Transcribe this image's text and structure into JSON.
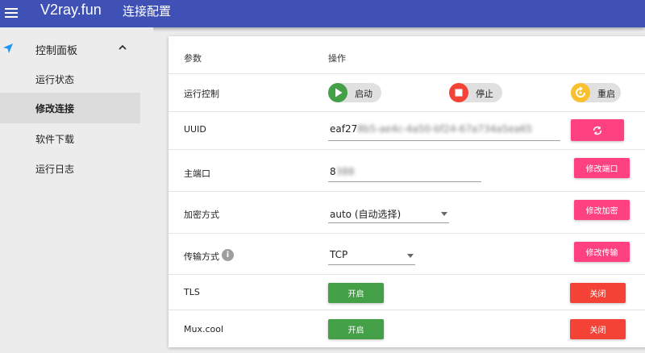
{
  "app": {
    "brand": "V2ray.fun",
    "page_title": "连接配置",
    "primary_color": "#3f51b5"
  },
  "sidebar": {
    "group_label": "控制面板",
    "items": [
      {
        "label": "运行状态"
      },
      {
        "label": "修改连接",
        "active": true
      },
      {
        "label": "软件下载"
      },
      {
        "label": "运行日志"
      }
    ]
  },
  "table": {
    "headers": {
      "param": "参数",
      "operation": "操作"
    },
    "run_control": {
      "label": "运行控制",
      "start_label": "启动",
      "start_color": "#43a047",
      "stop_label": "停止",
      "stop_color": "#f44336",
      "restart_label": "重启",
      "restart_color": "#fbc02d"
    },
    "uuid": {
      "label": "UUID",
      "value_visible": "eaf27",
      "value_obscured": "8b5-ae4c-4a50-bf24-67a734a5ea65"
    },
    "port": {
      "label": "主端口",
      "value_visible": "8",
      "value_obscured": "388",
      "button": "修改端口"
    },
    "encryption": {
      "label": "加密方式",
      "selected": "auto (自动选择)",
      "button": "修改加密"
    },
    "transport": {
      "label": "传输方式",
      "selected": "TCP",
      "button": "修改传输"
    },
    "tls": {
      "label": "TLS",
      "on_label": "开启",
      "off_label": "关闭"
    },
    "mux": {
      "label": "Mux.cool",
      "on_label": "开启",
      "off_label": "关闭"
    }
  },
  "icons": {
    "menu": "menu-icon",
    "nav": "navigation-arrow-icon",
    "chevron": "chevron-up-icon",
    "play": "play-icon",
    "stop": "stop-icon",
    "restart": "restart-icon",
    "refresh": "refresh-icon",
    "info": "info-icon"
  },
  "colors": {
    "accent": "#ff4081",
    "on": "#43a047",
    "off": "#f44336"
  }
}
